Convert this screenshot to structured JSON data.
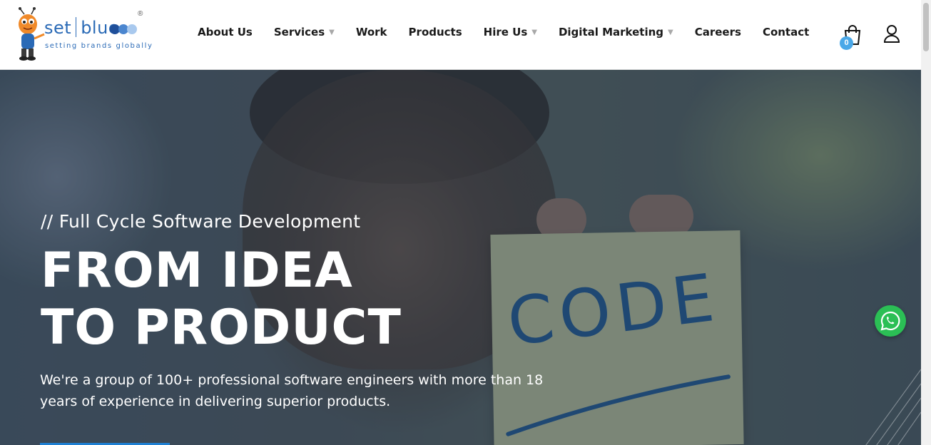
{
  "logo": {
    "name_left": "set",
    "name_right": "blue",
    "tagline": "setting brands globally",
    "registered": "®"
  },
  "nav": {
    "items": [
      {
        "label": "About Us",
        "dropdown": false
      },
      {
        "label": "Services",
        "dropdown": true
      },
      {
        "label": "Work",
        "dropdown": false
      },
      {
        "label": "Products",
        "dropdown": false
      },
      {
        "label": "Hire Us",
        "dropdown": true
      },
      {
        "label": "Digital Marketing",
        "dropdown": true
      },
      {
        "label": "Careers",
        "dropdown": false
      },
      {
        "label": "Contact",
        "dropdown": false
      }
    ]
  },
  "cart": {
    "count": "0",
    "icon": "shopping-bag-icon"
  },
  "account": {
    "icon": "user-icon"
  },
  "hero": {
    "subtitle": "// Full Cycle Software Development",
    "headline_line1": "FROM IDEA",
    "headline_line2": "TO PRODUCT",
    "description": "We're a group of 100+ professional software engineers with more than 18 years of experience in delivering superior products.",
    "note_text": "CODE"
  },
  "colors": {
    "brand_blue": "#2a6ab6",
    "badge_blue": "#4aa8e8",
    "whatsapp_green": "#2bbf55",
    "cta_blue": "#1f7fd1"
  }
}
